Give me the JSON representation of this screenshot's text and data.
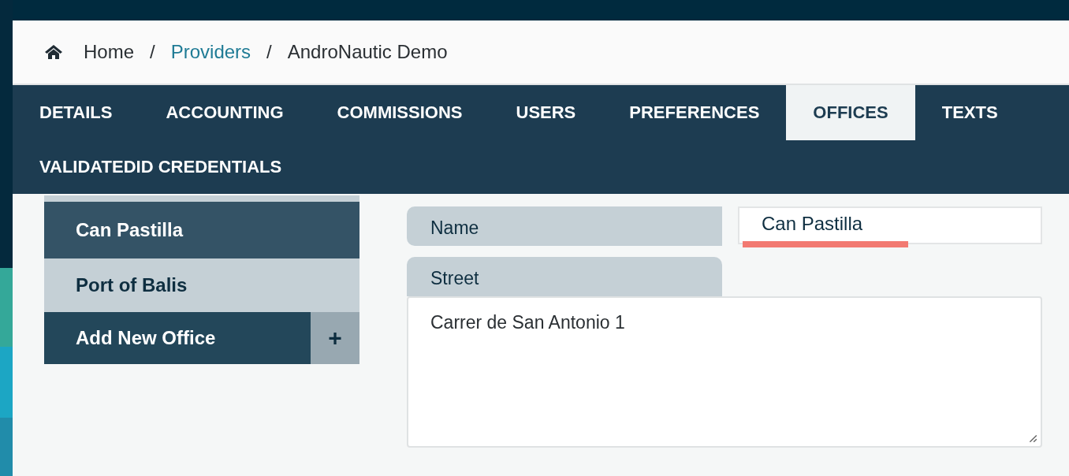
{
  "breadcrumb": [
    {
      "label": "Home",
      "kind": "home"
    },
    {
      "label": "Providers",
      "kind": "link"
    },
    {
      "label": "AndroNautic Demo",
      "kind": "current"
    }
  ],
  "breadcrumb_separator": "/",
  "tabs": [
    {
      "label": "DETAILS",
      "selected": false
    },
    {
      "label": "ACCOUNTING",
      "selected": false
    },
    {
      "label": "COMMISSIONS",
      "selected": false
    },
    {
      "label": "USERS",
      "selected": false
    },
    {
      "label": "PREFERENCES",
      "selected": false
    },
    {
      "label": "OFFICES",
      "selected": true
    },
    {
      "label": "TEXTS",
      "selected": false
    },
    {
      "label": "VALIDATEDID CREDENTIALS",
      "selected": false
    }
  ],
  "offices": [
    {
      "label": "Can Pastilla",
      "selected": true
    },
    {
      "label": "Port of Balis",
      "selected": false
    }
  ],
  "add_office": {
    "label": "Add New Office",
    "icon": "+"
  },
  "form": {
    "name": {
      "label": "Name",
      "value": "Can Pastilla"
    },
    "street": {
      "label": "Street",
      "value": "Carrer de San Antonio 1"
    }
  }
}
